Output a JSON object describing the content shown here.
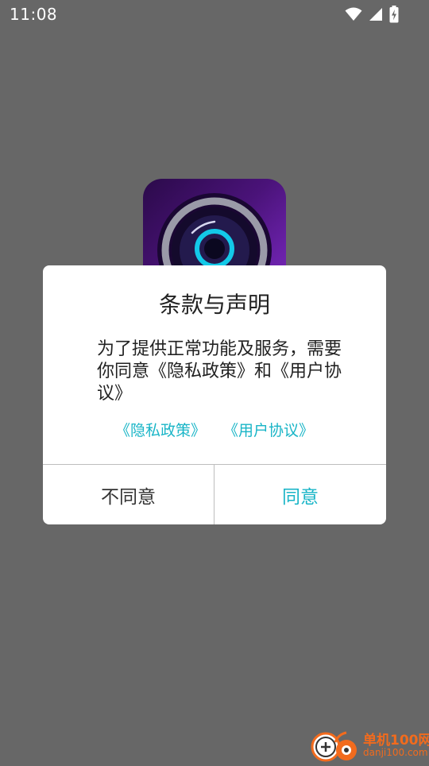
{
  "status_bar": {
    "time": "11:08",
    "icons": [
      "wifi-icon",
      "cellular-signal-icon",
      "battery-charging-icon"
    ]
  },
  "app_icon": {
    "name": "camera-lens-app-icon"
  },
  "dialog": {
    "title": "条款与声明",
    "message": "为了提供正常功能及服务，需要你同意《隐私政策》和《用户协议》",
    "links": {
      "privacy": "《隐私政策》",
      "user_agreement": "《用户协议》"
    },
    "buttons": {
      "disagree": "不同意",
      "agree": "同意"
    }
  },
  "watermark": {
    "name": "单机100网",
    "url": "danji100.com"
  },
  "colors": {
    "overlay_background": "#676767",
    "accent": "#19b5c7",
    "watermark": "#f26b1d"
  }
}
